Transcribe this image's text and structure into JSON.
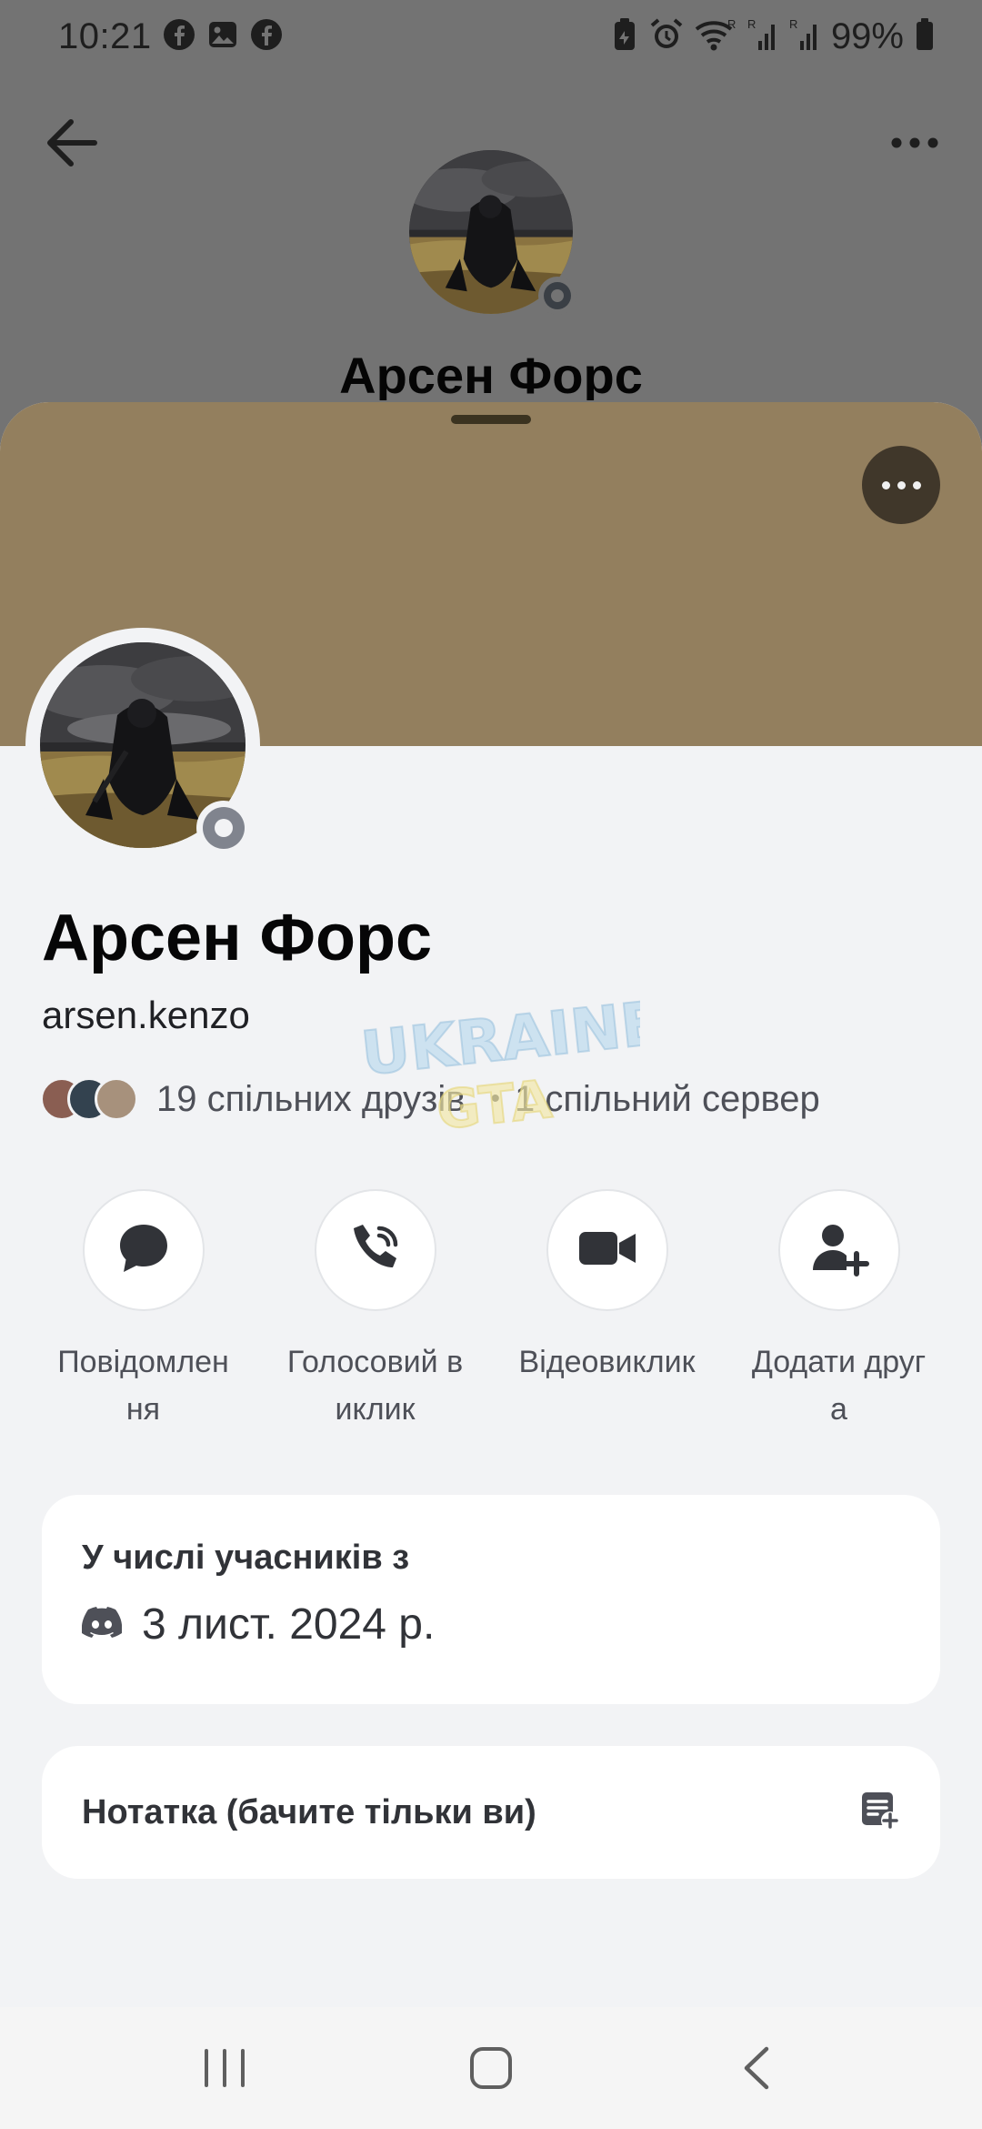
{
  "status_bar": {
    "time": "10:21",
    "battery": "99%",
    "left_icons": [
      "facebook-icon",
      "gallery-icon",
      "facebook-icon"
    ],
    "right_icons": [
      "battery-saver-icon",
      "alarm-icon",
      "wifi-icon",
      "signal-icon",
      "signal-icon",
      "battery-icon"
    ]
  },
  "background_header": {
    "name": "Арсен Форс"
  },
  "profile": {
    "display_name": "Арсен Форс",
    "username": "arsen.kenzo",
    "mutual_friends": "19 спільних друзів",
    "mutual_servers": "1 спільний сервер",
    "status": "offline"
  },
  "watermark": {
    "line1": "UKRAINE",
    "line2": "GTA"
  },
  "actions": [
    {
      "label": "Повідомлення",
      "icon": "chat-bubble-icon"
    },
    {
      "label": "Голосовий виклик",
      "icon": "phone-call-icon"
    },
    {
      "label": "Відеовиклик",
      "icon": "video-camera-icon"
    },
    {
      "label": "Додати друга",
      "icon": "add-friend-icon"
    }
  ],
  "member_since": {
    "title": "У числі учасників з",
    "date": "3 лист. 2024 р."
  },
  "note": {
    "label": "Нотатка (бачите тільки ви)"
  },
  "colors": {
    "banner": "#937f5e",
    "sheet_background": "#f2f3f5",
    "dimmed_background": "#737373"
  }
}
